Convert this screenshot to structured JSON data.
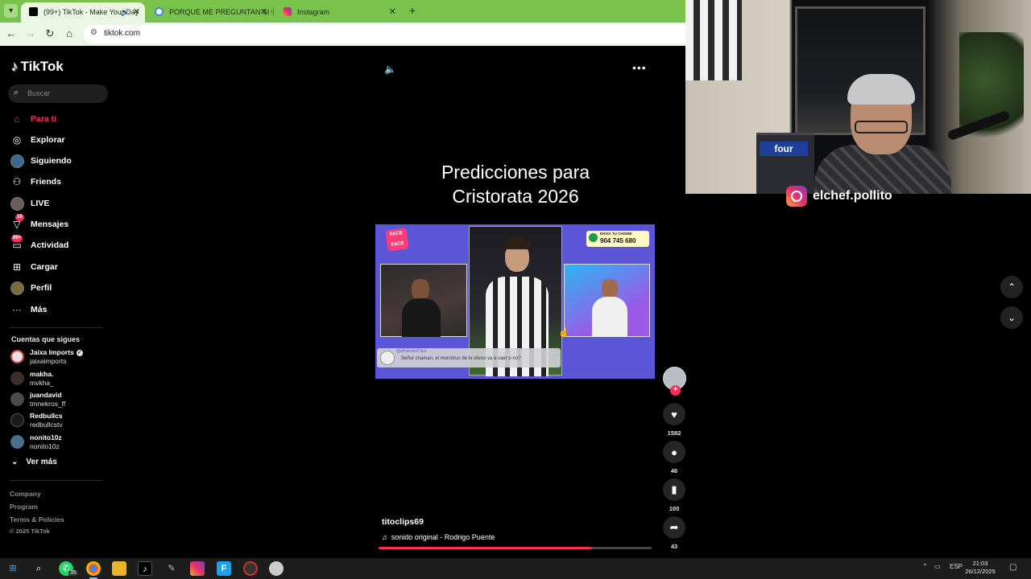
{
  "browser": {
    "tabs": [
      {
        "title": "(99+) TikTok - Make Your Day",
        "active": true
      },
      {
        "title": "PORQUE ME PREGUNTAN SI CO",
        "active": false
      },
      {
        "title": "Instagram",
        "active": false
      }
    ],
    "url": "tiktok.com",
    "icons": {
      "back": "←",
      "forward": "→",
      "reload": "↻",
      "home": "⌂",
      "new_tab": "+",
      "close": "✕",
      "audio": "🔊"
    }
  },
  "tiktok": {
    "brand": "TikTok",
    "search_placeholder": "Buscar",
    "nav": [
      {
        "label": "Para ti",
        "icon": "home-icon",
        "active": true
      },
      {
        "label": "Explorar",
        "icon": "compass-icon"
      },
      {
        "label": "Siguiendo",
        "icon": "following-avatar"
      },
      {
        "label": "Friends",
        "icon": "friends-icon"
      },
      {
        "label": "LIVE",
        "icon": "live-avatar"
      },
      {
        "label": "Mensajes",
        "icon": "messages-icon",
        "badge": "10"
      },
      {
        "label": "Actividad",
        "icon": "activity-icon",
        "badge": "99+"
      },
      {
        "label": "Cargar",
        "icon": "upload-icon"
      },
      {
        "label": "Perfil",
        "icon": "profile-avatar"
      },
      {
        "label": "Más",
        "icon": "more-icon"
      }
    ],
    "following_heading": "Cuentas que sigues",
    "following": [
      {
        "name": "Jaixa Imports",
        "handle": "jaixaimports",
        "verified": true
      },
      {
        "name": "makha.",
        "handle": "mvkha_"
      },
      {
        "name": "juandavid",
        "handle": "tmnekros_ff"
      },
      {
        "name": "Redbullcs",
        "handle": "redbullcstv"
      },
      {
        "name": "nonito10z",
        "handle": "nonito10z"
      }
    ],
    "see_more": "Ver más",
    "footer_links": [
      "Company",
      "Program",
      "Terms & Policies"
    ],
    "copyright": "© 2025 TikTok"
  },
  "video": {
    "title_line1": "Predicciones para",
    "title_line2": "Cristorata 2026",
    "author": "titoclips69",
    "sound": "sonido original - Rodrigo Puente",
    "progress_fraction": 0.78,
    "frame": {
      "phone_label": "ENVÍA TU CHISME",
      "phone_number": "904 745 680",
      "caption_handle": "@ePaloneoClips",
      "caption_text": "Señor chaman, el monstruo de lo olivos va a caer o no?"
    },
    "actions": [
      {
        "name": "like",
        "icon": "heart-icon",
        "glyph": "♥",
        "count": "1582"
      },
      {
        "name": "comment",
        "icon": "comment-icon",
        "glyph": "●",
        "count": "46"
      },
      {
        "name": "save",
        "icon": "bookmark-icon",
        "glyph": "▮",
        "count": "100"
      },
      {
        "name": "share",
        "icon": "share-icon",
        "glyph": "➦",
        "count": "43"
      }
    ]
  },
  "overlay": {
    "instagram_handle": "elchef.pollito",
    "shelf_brand": "four"
  },
  "taskbar": {
    "whatsapp_badge": "35",
    "language": "ESP",
    "time": "21:03",
    "date": "26/12/2025"
  }
}
